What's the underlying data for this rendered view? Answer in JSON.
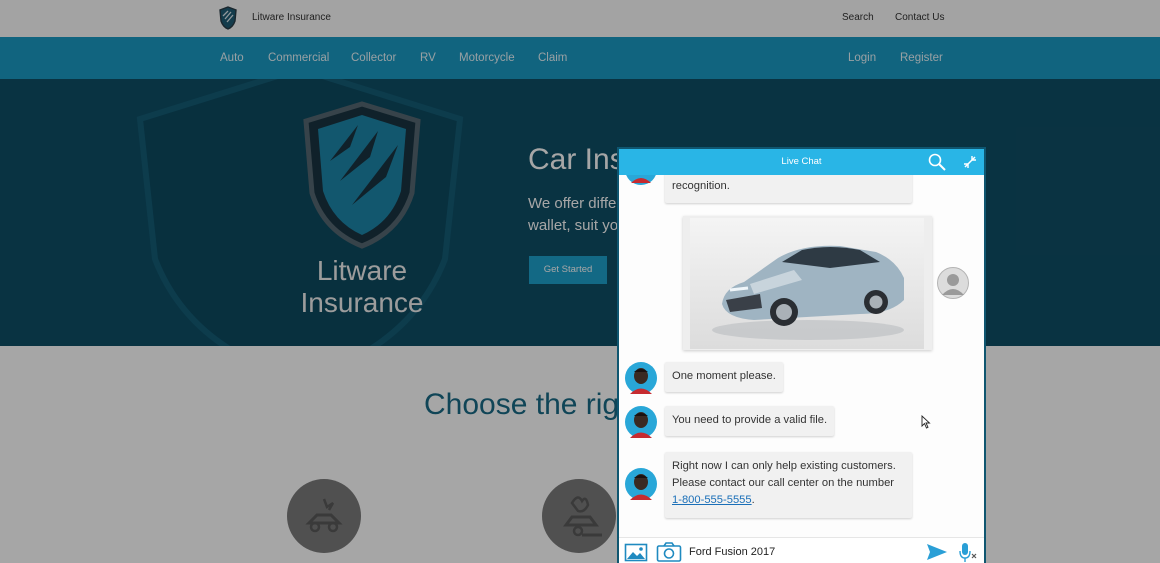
{
  "site": {
    "brand_name": "Litware Insurance",
    "top_links": [
      "Search",
      "Contact Us"
    ],
    "nav_left": [
      "Auto",
      "Commercial",
      "Collector",
      "RV",
      "Motorcycle",
      "Claim"
    ],
    "nav_right": [
      "Login",
      "Register"
    ],
    "hero": {
      "brand_line1": "Litware",
      "brand_line2": "Insurance",
      "title": "Car Ins",
      "subtitle": "We offer diffe wallet, suit you",
      "cta": "Get Started"
    },
    "section_title": "Choose the righ",
    "colors": {
      "nav": "#1b9ac4",
      "hero": "#0f4f66",
      "accent": "#29b5e6"
    }
  },
  "chat": {
    "title": "Live Chat",
    "header_icons": [
      "search-icon",
      "minimize-icon"
    ],
    "messages": {
      "partial": "recognition.",
      "m1": "One moment please.",
      "m2": "You need to provide a valid file.",
      "m3_line1": "Right now I can only help existing customers.",
      "m3_line2": "Please contact our call center on the number",
      "m3_phone": "1-800-555-5555",
      "m3_period": "."
    },
    "input": {
      "value": "Ford Fusion 2017",
      "icons": [
        "image-icon",
        "camera-icon",
        "send-icon",
        "microphone-icon"
      ]
    }
  }
}
